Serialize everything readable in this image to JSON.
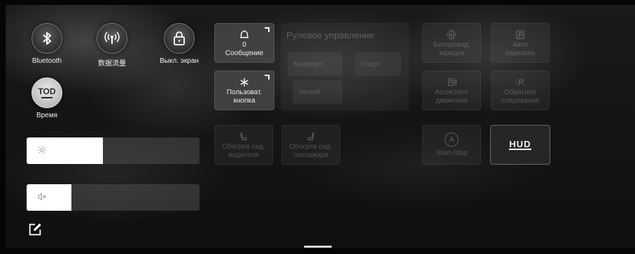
{
  "toggles": [
    {
      "label": "Bluetooth",
      "icon": "bluetooth-icon"
    },
    {
      "label": "数据流量",
      "icon": "mobile-data-icon"
    },
    {
      "label": "Выкл. экран",
      "icon": "lock-screen-icon"
    },
    {
      "label": "Время",
      "icon": "tod-icon",
      "icon_text": "TOD"
    }
  ],
  "tiles": {
    "message": {
      "label": "Сообщение",
      "sub": "0",
      "icon": "bell-icon"
    },
    "custom": {
      "label_line1": "Пользоват.",
      "label_line2": "кнопка",
      "icon": "asterisk-icon"
    },
    "wireless_charging": {
      "label_line1": "Беспровод.",
      "label_line2": "зарядка",
      "icon": "wireless-charging-icon"
    },
    "auto_parking": {
      "label_line1": "Авто",
      "label_line2": "парковка",
      "icon": "parking-icon"
    },
    "drive_assist": {
      "label_line1": "Ассистент",
      "label_line2": "движения",
      "icon": "drive-assist-icon"
    },
    "reverse": {
      "label_line1": "Обратное",
      "label_line2": "следование",
      "icon": "reverse-parking-icon"
    },
    "driver_seat_heat": {
      "label_line1": "Обогрев сид.",
      "label_line2": "водителя",
      "icon": "seat-heat-icon"
    },
    "passenger_seat_heat": {
      "label_line1": "Обогрев сид.",
      "label_line2": "пассажира",
      "icon": "seat-heat-icon"
    },
    "start_stop": {
      "label": "Start-Stop",
      "icon": "start-stop-icon",
      "icon_text": "A"
    },
    "hud": {
      "label": "HUD"
    }
  },
  "steering": {
    "title": "Рулевое управление",
    "modes": [
      "Комфорт",
      "Спорт",
      "Легкий"
    ]
  },
  "sliders": {
    "brightness": {
      "icon": "brightness-icon",
      "level_percent": 44
    },
    "volume": {
      "icon": "mute-icon",
      "level_percent": 26
    }
  },
  "edit_icon": "edit-icon"
}
